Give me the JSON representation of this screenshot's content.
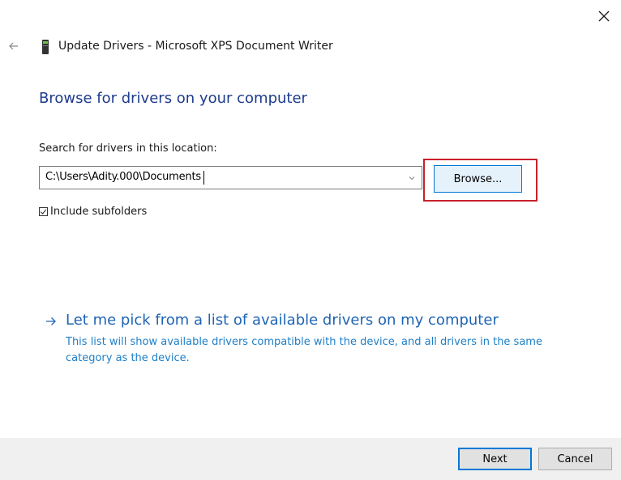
{
  "window": {
    "title": "Update Drivers - Microsoft XPS Document Writer",
    "back_icon": "back-arrow-icon",
    "close_icon": "close-icon",
    "device_icon": "printer-device-icon"
  },
  "main": {
    "heading": "Browse for drivers on your computer",
    "search_label": "Search for drivers in this location:",
    "path_value": "C:\\Users\\Adity.000\\Documents",
    "browse_label": "Browse...",
    "include_subfolders": {
      "label": "Include subfolders",
      "checked": true
    }
  },
  "pick_option": {
    "title": "Let me pick from a list of available drivers on my computer",
    "description": "This list will show available drivers compatible with the device, and all drivers in the same category as the device."
  },
  "footer": {
    "next_label": "Next",
    "cancel_label": "Cancel"
  },
  "colors": {
    "heading": "#1e3c8c",
    "link": "#1e64b4",
    "highlight": "#c8202a",
    "accent": "#0078d7"
  }
}
